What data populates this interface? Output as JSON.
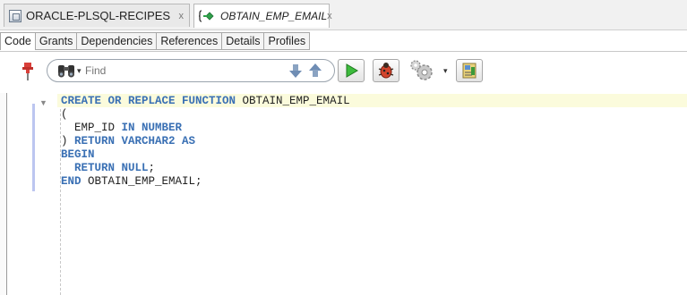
{
  "doc_tabs": [
    {
      "title": "ORACLE-PLSQL-RECIPES",
      "close": "x"
    },
    {
      "title": "OBTAIN_EMP_EMAIL",
      "close": "x"
    }
  ],
  "sub_tabs": [
    "Code",
    "Grants",
    "Dependencies",
    "References",
    "Details",
    "Profiles"
  ],
  "toolbar": {
    "search_placeholder": "Find"
  },
  "code": {
    "lines": [
      [
        {
          "t": "CREATE OR REPLACE FUNCTION ",
          "k": true
        },
        {
          "t": "OBTAIN_EMP_EMAIL",
          "k": false
        }
      ],
      [
        {
          "t": "(",
          "k": false
        }
      ],
      [
        {
          "t": "  EMP_ID ",
          "k": false
        },
        {
          "t": "IN NUMBER",
          "k": true
        }
      ],
      [
        {
          "t": ") ",
          "k": false
        },
        {
          "t": "RETURN VARCHAR2 AS",
          "k": true
        }
      ],
      [
        {
          "t": "BEGIN",
          "k": true
        }
      ],
      [
        {
          "t": "  RETURN NULL",
          "k": true
        },
        {
          "t": ";",
          "k": false
        }
      ],
      [
        {
          "t": "END ",
          "k": true
        },
        {
          "t": "OBTAIN_EMP_EMAIL;",
          "k": false
        }
      ]
    ]
  },
  "colors": {
    "keyword": "#3a70b4",
    "current_line": "#fbfbdc",
    "modified_marker": "#bcc6f0"
  },
  "icons": [
    "database-icon",
    "function-icon",
    "pin-icon",
    "binoculars-icon",
    "find-previous-icon",
    "find-next-icon",
    "run-icon",
    "debug-icon",
    "gear-icon",
    "compile-icon",
    "fold-icon"
  ]
}
